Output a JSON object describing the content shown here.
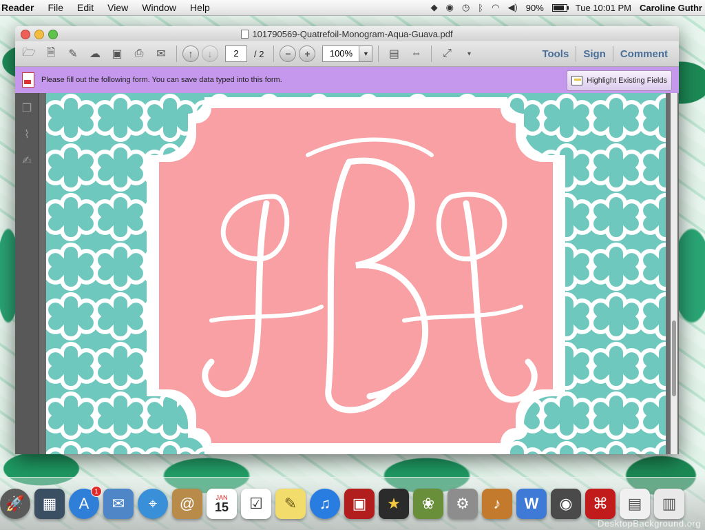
{
  "menubar": {
    "app_name": "Reader",
    "items": [
      "File",
      "Edit",
      "View",
      "Window",
      "Help"
    ],
    "battery_percent": "90%",
    "clock": "Tue 10:01 PM",
    "user": "Caroline Guthr"
  },
  "window": {
    "title": "101790569-Quatrefoil-Monogram-Aqua-Guava.pdf"
  },
  "toolbar": {
    "page_current": "2",
    "page_total": "/ 2",
    "zoom": "100%",
    "tools_label": "Tools",
    "sign_label": "Sign",
    "comment_label": "Comment"
  },
  "formbar": {
    "message": "Please fill out the following form. You can save data typed into this form.",
    "highlight_label": "Highlight Existing Fields"
  },
  "document": {
    "monogram": "JBJ",
    "colors": {
      "aqua": "#6ec8bd",
      "guava": "#f8a0a4",
      "white": "#ffffff"
    }
  },
  "dock": {
    "app_store_badge": "1",
    "calendar_month": "JAN",
    "calendar_day": "15"
  },
  "watermark": "DesktopBackground.org"
}
